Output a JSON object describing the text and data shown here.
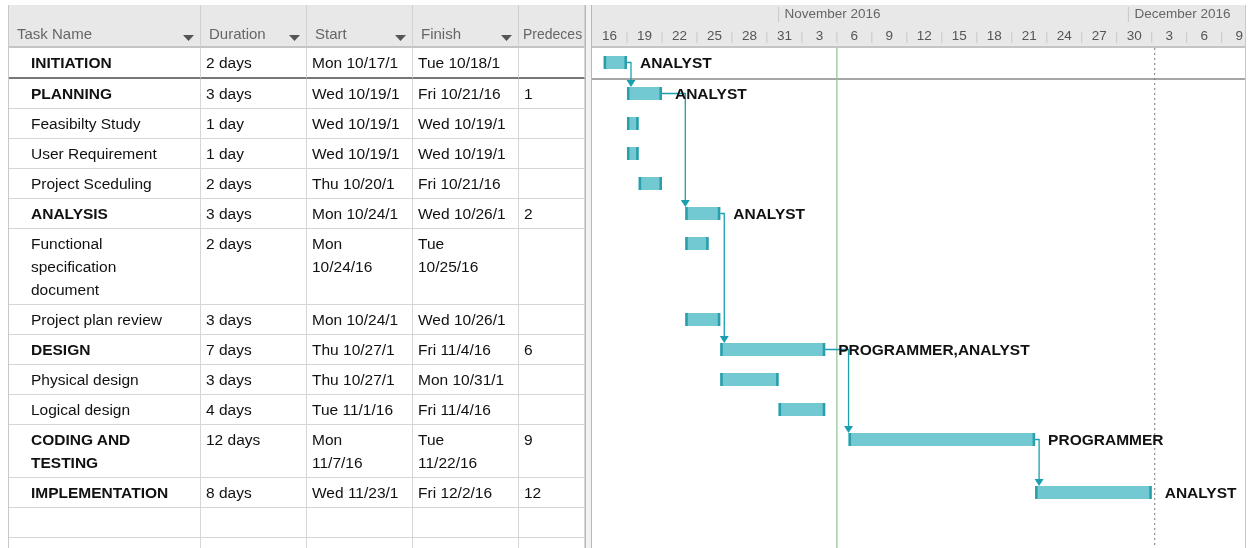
{
  "table": {
    "columns": [
      "Task Name",
      "Duration",
      "Start",
      "Finish",
      "Predeces"
    ],
    "rows": [
      {
        "name": "INITIATION",
        "summary": true,
        "duration": "2 days",
        "start": "Mon 10/17/1",
        "finish": "Tue 10/18/1",
        "bar_label": "ANALYST"
      },
      {
        "name": "PLANNING",
        "summary": true,
        "duration": "3 days",
        "start": "Wed 10/19/1",
        "finish": "Fri 10/21/16",
        "predecessors": "1",
        "bar_label": "ANALYST"
      },
      {
        "name": "Feasibilty Study",
        "summary": false,
        "duration": "1 day",
        "start": "Wed 10/19/1",
        "finish": "Wed 10/19/1"
      },
      {
        "name": "User Requirement",
        "summary": false,
        "duration": "1 day",
        "start": "Wed 10/19/1",
        "finish": "Wed 10/19/1"
      },
      {
        "name": "Project Sceduling",
        "summary": false,
        "duration": "2 days",
        "start": "Thu 10/20/1",
        "finish": "Fri 10/21/16"
      },
      {
        "name": "ANALYSIS",
        "summary": true,
        "duration": "3 days",
        "start": "Mon 10/24/1",
        "finish": "Wed 10/26/1",
        "predecessors": "2",
        "bar_label": "ANALYST"
      },
      {
        "name": "Functional\nspecification\ndocument",
        "summary": false,
        "duration": "2 days",
        "start": "Mon\n10/24/16",
        "finish": "Tue\n10/25/16"
      },
      {
        "name": "Project plan review",
        "summary": false,
        "duration": "3 days",
        "start": "Mon 10/24/1",
        "finish": "Wed 10/26/1"
      },
      {
        "name": "DESIGN",
        "summary": true,
        "duration": "7 days",
        "start": "Thu 10/27/1",
        "finish": "Fri 11/4/16",
        "predecessors": "6",
        "bar_label": "PROGRAMMER,ANALYST"
      },
      {
        "name": "Physical design",
        "summary": false,
        "duration": "3 days",
        "start": "Thu 10/27/1",
        "finish": "Mon 10/31/1"
      },
      {
        "name": "Logical design",
        "summary": false,
        "duration": "4 days",
        "start": "Tue 11/1/16",
        "finish": "Fri 11/4/16"
      },
      {
        "name": "CODING AND\nTESTING",
        "summary": true,
        "duration": "12 days",
        "start": "Mon\n11/7/16",
        "finish": "Tue\n11/22/16",
        "predecessors": "9",
        "bar_label": "PROGRAMMER"
      },
      {
        "name": "IMPLEMENTATION",
        "summary": true,
        "duration": "8 days",
        "start": "Wed 11/23/1",
        "finish": "Fri 12/2/16",
        "predecessors": "12",
        "bar_label": "ANALYST"
      }
    ]
  },
  "gantt": {
    "months": [
      "November 2016",
      "December 2016"
    ],
    "days": [
      "16",
      "19",
      "22",
      "25",
      "28",
      "31",
      "3",
      "6",
      "9",
      "12",
      "15",
      "18",
      "21",
      "24",
      "27",
      "30",
      "3",
      "6",
      "9"
    ]
  }
}
